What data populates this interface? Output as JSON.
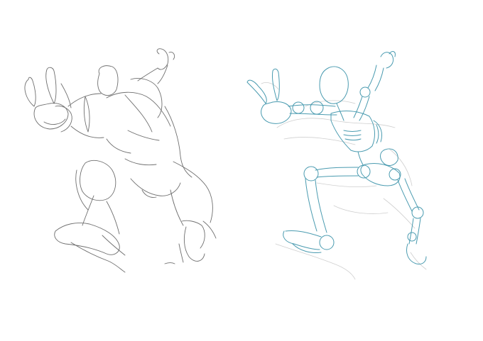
{
  "colors": {
    "background": "#ffffff",
    "sketch_stroke": "#6f6f6f",
    "ghost_stroke": "#cfcfcf",
    "skeleton_stroke": "#4a9bb0"
  },
  "panels": [
    {
      "name": "rough-gesture-sketch"
    },
    {
      "name": "skeleton-construction-sketch"
    }
  ]
}
